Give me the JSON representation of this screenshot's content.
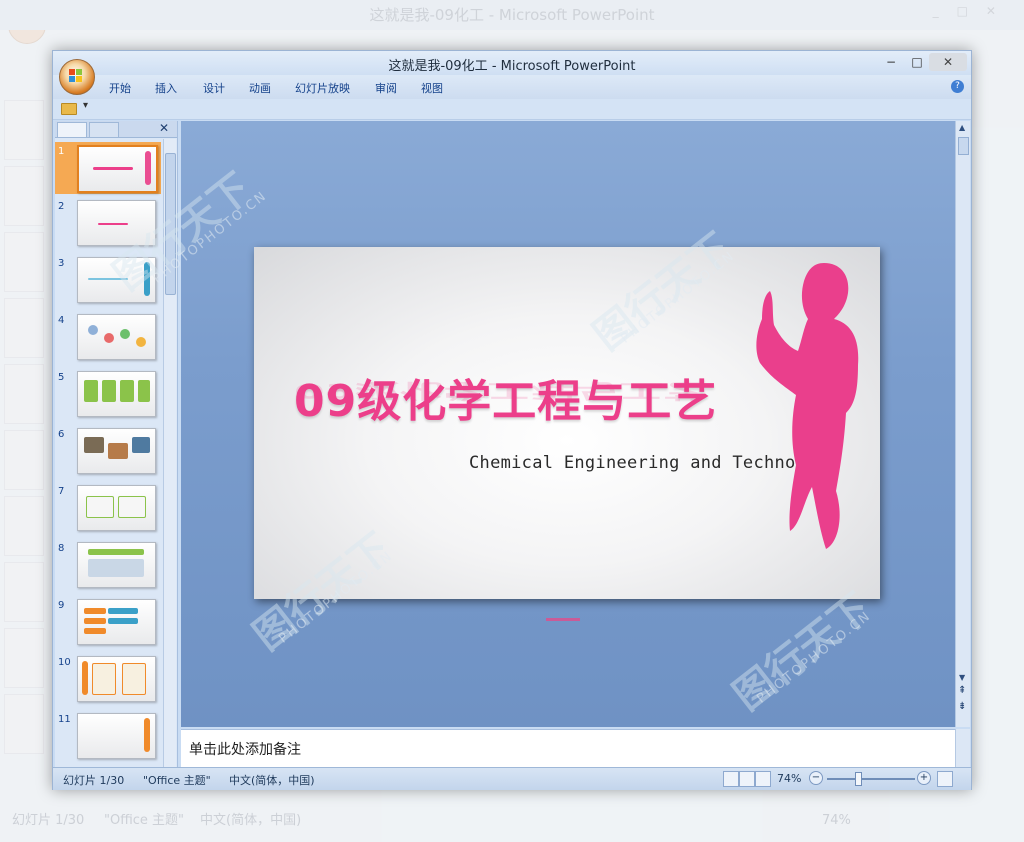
{
  "background_window": {
    "title": "这就是我-09化工 - Microsoft PowerPoint",
    "status_slide": "幻灯片 1/30",
    "status_theme": "\"Office 主题\"",
    "status_lang": "中文(简体，中国)",
    "status_zoom": "74%"
  },
  "window": {
    "title": "这就是我-09化工 - Microsoft PowerPoint",
    "minimize": "−",
    "maximize": "□",
    "close": "✕"
  },
  "menu": {
    "items": [
      "开始",
      "插入",
      "设计",
      "动画",
      "幻灯片放映",
      "审阅",
      "视图"
    ],
    "help": "?"
  },
  "thumbnail_pane": {
    "close": "✕",
    "slides": [
      {
        "num": "1"
      },
      {
        "num": "2"
      },
      {
        "num": "3"
      },
      {
        "num": "4"
      },
      {
        "num": "5"
      },
      {
        "num": "6"
      },
      {
        "num": "7"
      },
      {
        "num": "8"
      },
      {
        "num": "9"
      },
      {
        "num": "10"
      },
      {
        "num": "11"
      }
    ],
    "selected_index": 0
  },
  "slide": {
    "title": "09级化学工程与工艺",
    "subtitle": "Chemical Engineering and Technology",
    "accent_color": "#ec3f8a"
  },
  "notes": {
    "placeholder": "单击此处添加备注"
  },
  "status": {
    "slide": "幻灯片 1/30",
    "theme": "\"Office 主题\"",
    "language": "中文(简体，中国)",
    "zoom": "74%",
    "zoom_minus": "−",
    "zoom_plus": "+"
  }
}
